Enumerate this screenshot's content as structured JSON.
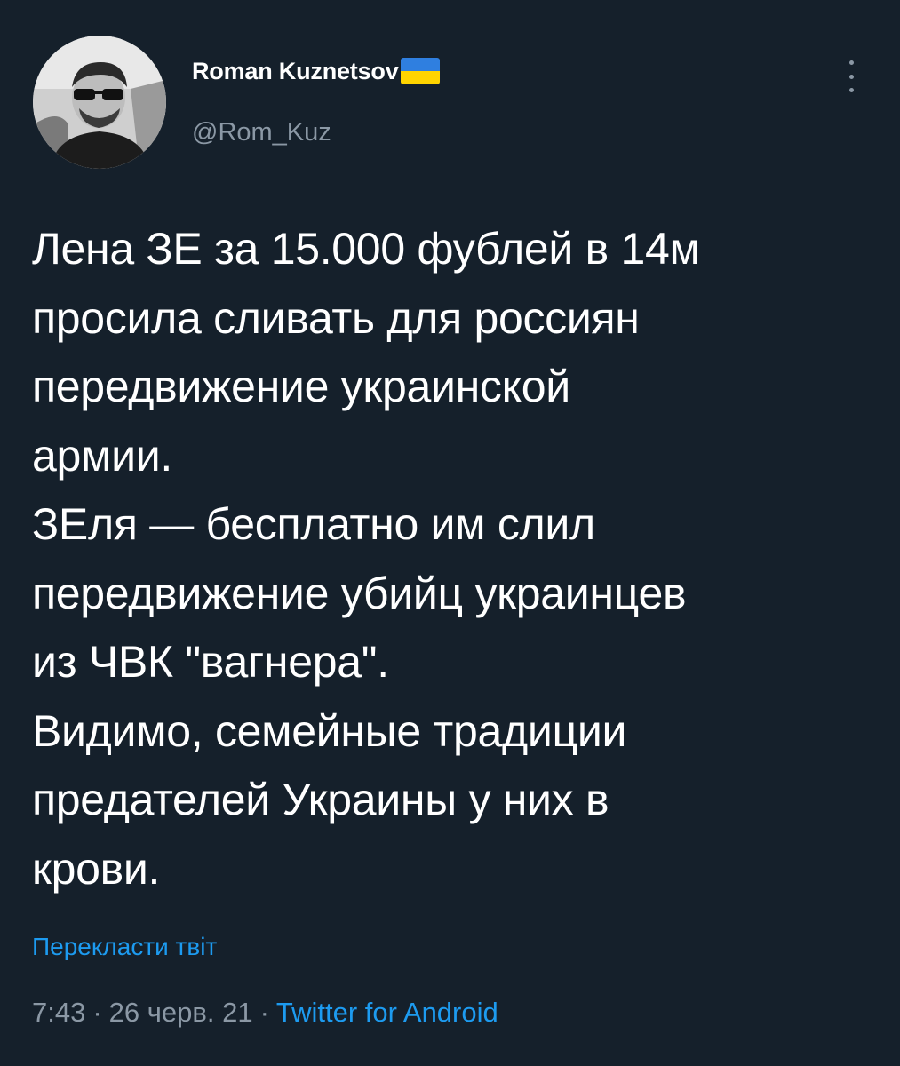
{
  "tweet": {
    "author": {
      "display_name": "Roman Kuznetsov",
      "handle": "@Rom_Kuz",
      "flag": "ukraine-flag"
    },
    "body_lines": [
      "Лена ЗЕ за 15.000 фублей в 14м",
      "просила сливать для россиян",
      "передвижение украинской",
      "армии.",
      "ЗЕля — бесплатно им слил",
      "передвижение убийц украинцев",
      "из ЧВК \"вагнера\".",
      "Видимо, семейные традиции",
      "предателей Украины у них в",
      "крови."
    ],
    "translate_label": "Перекласти твіт",
    "time": "7:43",
    "date": "26 черв. 21",
    "separator": "·",
    "source": "Twitter for Android"
  },
  "icons": {
    "more": "more-vertical-icon"
  },
  "colors": {
    "background": "#15202b",
    "text": "#ffffff",
    "muted": "#8b98a5",
    "accent": "#1d9bf0",
    "flag_blue": "#2f7fe0",
    "flag_yellow": "#ffd400"
  }
}
